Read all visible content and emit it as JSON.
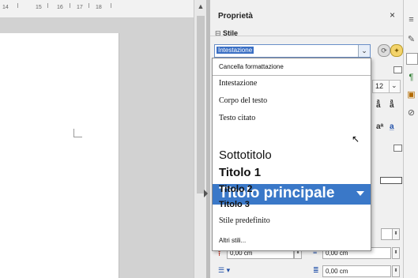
{
  "ruler": {
    "labels": [
      "14",
      "15",
      "16",
      "17",
      "18"
    ]
  },
  "panel": {
    "title": "Proprietà",
    "close_glyph": "×",
    "section_style": "Stile",
    "style_combo_value": "Intestazione",
    "font_size": "12",
    "spacing_above": "0,00 cm",
    "spacing_below": "0,00 cm",
    "indent_before": "0,00 cm",
    "indent_first": "0,00 cm"
  },
  "dropdown": {
    "items": [
      {
        "label": "Cancella formattazione"
      },
      {
        "label": "Intestazione"
      },
      {
        "label": "Corpo del testo"
      },
      {
        "label": "Testo citato"
      },
      {
        "label": "Titolo principale"
      },
      {
        "label": "Sottotitolo"
      },
      {
        "label": "Titolo 1"
      },
      {
        "label": "Titolo 2"
      },
      {
        "label": "Titolo 3"
      },
      {
        "label": "Stile predefinito"
      },
      {
        "label": "Altri stili..."
      }
    ],
    "selected_index": 4
  },
  "colors": {
    "accent": "#3a78c8",
    "panel_bg": "#f0f0f0"
  },
  "icons": [
    "close-icon",
    "update-style-icon",
    "new-style-icon",
    "chevron-down-icon",
    "properties-icon",
    "gallery-icon",
    "navigator-icon",
    "styles-icon"
  ]
}
